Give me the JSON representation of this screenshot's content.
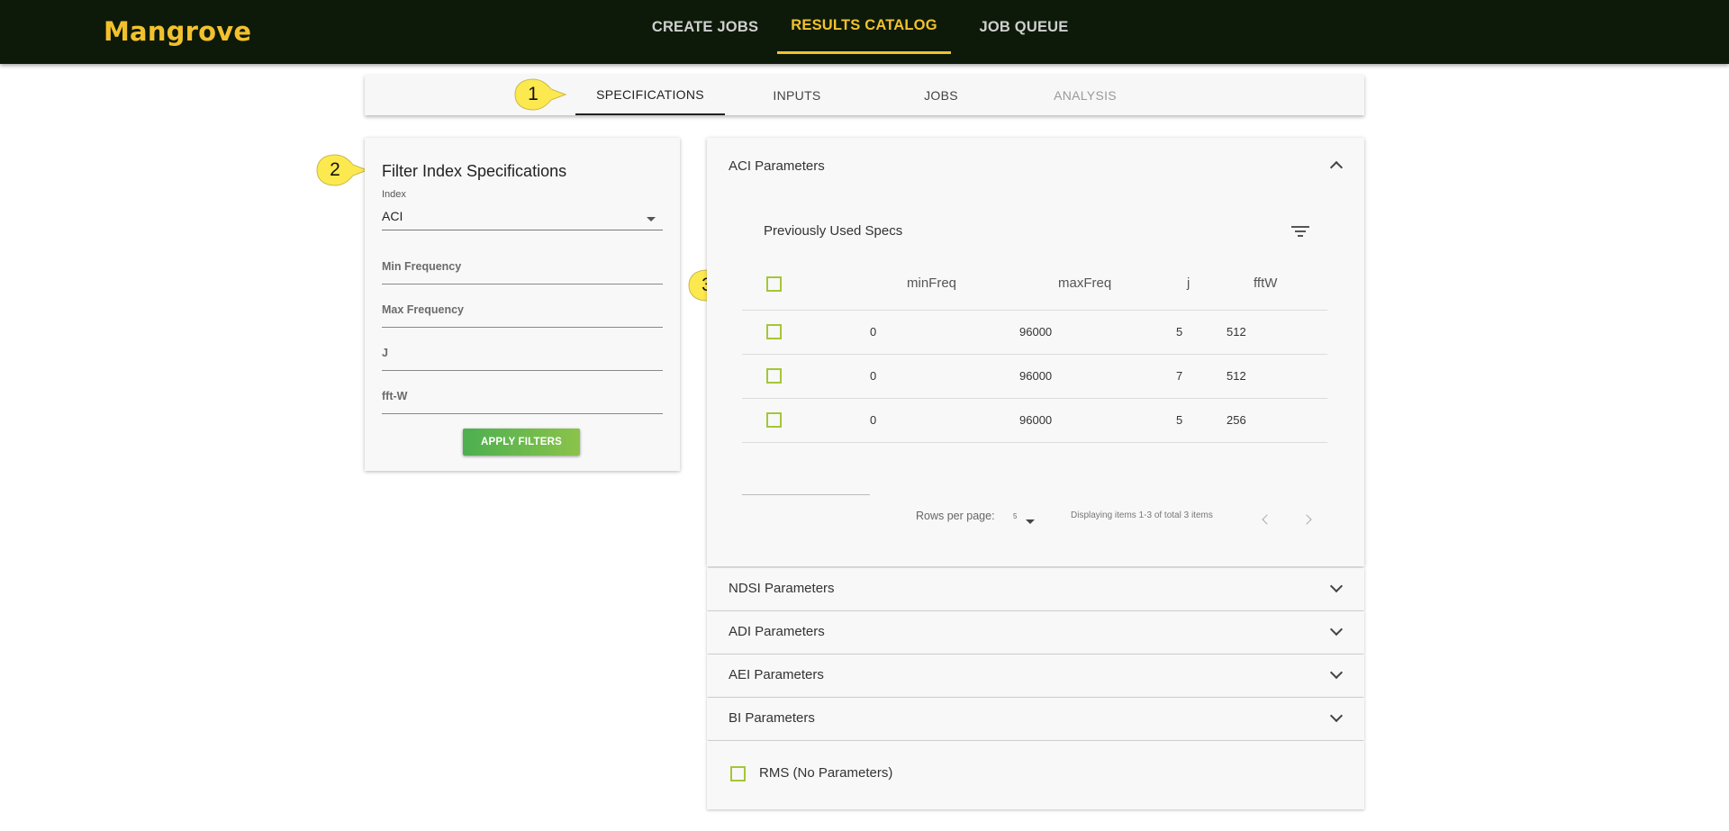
{
  "app": {
    "brand": "Mangrove"
  },
  "topnav": {
    "items": [
      {
        "label": "CREATE JOBS",
        "active": false
      },
      {
        "label": "RESULTS CATALOG",
        "active": true
      },
      {
        "label": "JOB QUEUE",
        "active": false
      }
    ]
  },
  "tabs": {
    "items": [
      {
        "label": "SPECIFICATIONS",
        "state": "active"
      },
      {
        "label": "INPUTS",
        "state": "normal"
      },
      {
        "label": "JOBS",
        "state": "normal"
      },
      {
        "label": "ANALYSIS",
        "state": "disabled"
      }
    ]
  },
  "callouts": [
    "1",
    "2",
    "3"
  ],
  "filter": {
    "title": "Filter Index Specifications",
    "index_label": "Index",
    "index_value": "ACI",
    "fields": [
      "Min Frequency",
      "Max Frequency",
      "J",
      "fft-W"
    ],
    "apply_label": "APPLY FILTERS"
  },
  "aci": {
    "title": "ACI Parameters",
    "table_title": "Previously Used Specs",
    "headers": [
      "minFreq",
      "maxFreq",
      "j",
      "fftW"
    ],
    "rows": [
      {
        "minFreq": "0",
        "maxFreq": "96000",
        "j": "5",
        "fftW": "512"
      },
      {
        "minFreq": "0",
        "maxFreq": "96000",
        "j": "7",
        "fftW": "512"
      },
      {
        "minFreq": "0",
        "maxFreq": "96000",
        "j": "5",
        "fftW": "256"
      }
    ],
    "rows_per_page_label": "Rows per page:",
    "rows_per_page_value": "5",
    "display_text": "Displaying items 1-3 of total 3 items"
  },
  "panels": [
    "NDSI Parameters",
    "ADI Parameters",
    "AEI Parameters",
    "BI Parameters"
  ],
  "rms": {
    "label": "RMS (No Parameters)"
  },
  "colors": {
    "brand": "#f2c12e",
    "topbar": "#0d1a09",
    "checkbox": "#a4c639",
    "callout": "#fce94f"
  }
}
